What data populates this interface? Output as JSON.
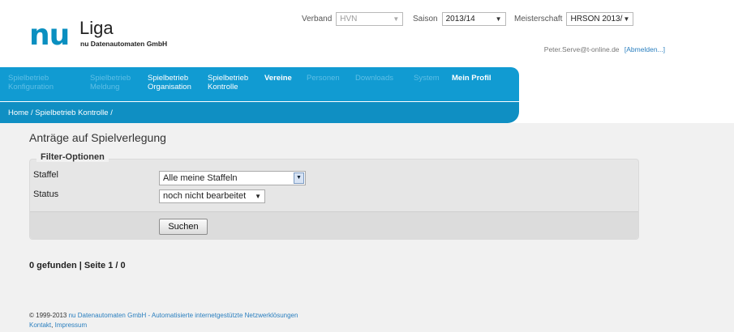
{
  "logo": {
    "brand": "nu",
    "product": "Liga",
    "company": "nu Datenautomaten GmbH"
  },
  "selectors": {
    "verband": {
      "label": "Verband",
      "value": "HVN"
    },
    "saison": {
      "label": "Saison",
      "value": "2013/14"
    },
    "meisterschaft": {
      "label": "Meisterschaft",
      "value": "HRSON 2013/"
    }
  },
  "user": {
    "email": "Peter.Serve@t-online.de",
    "logout": "[Abmelden...]"
  },
  "nav": {
    "items": [
      {
        "line1": "Spielbetrieb",
        "line2": "Konfiguration"
      },
      {
        "line1": "Spielbetrieb",
        "line2": "Meldung"
      },
      {
        "line1": "Spielbetrieb",
        "line2": "Organisation"
      },
      {
        "line1": "Spielbetrieb",
        "line2": "Kontrolle"
      },
      {
        "line1": "Vereine"
      },
      {
        "line1": "Personen"
      },
      {
        "line1": "Downloads"
      },
      {
        "line1": "System"
      },
      {
        "line1": "Mein Profil"
      }
    ]
  },
  "breadcrumb": "Home / Spielbetrieb Kontrolle /",
  "page_title": "Anträge auf Spielverlegung",
  "filter": {
    "legend": "Filter-Optionen",
    "staffel_label": "Staffel",
    "staffel_value": "Alle meine Staffeln",
    "status_label": "Status",
    "status_value": "noch nicht bearbeitet",
    "search_button": "Suchen"
  },
  "result": "0 gefunden | Seite 1 / 0",
  "footer": {
    "copyright_year": "© 1999-2013",
    "company_link": "nu Datenautomaten GmbH",
    "tagline": "- Automatisierte internetgestützte Netzwerklösungen",
    "kontakt": "Kontakt",
    "sep": ",",
    "impressum": "Impressum"
  },
  "colors": {
    "nav_blue": "#119bd2",
    "link_blue": "#2a7fbf",
    "logo_blue": "#0a8fc0"
  }
}
